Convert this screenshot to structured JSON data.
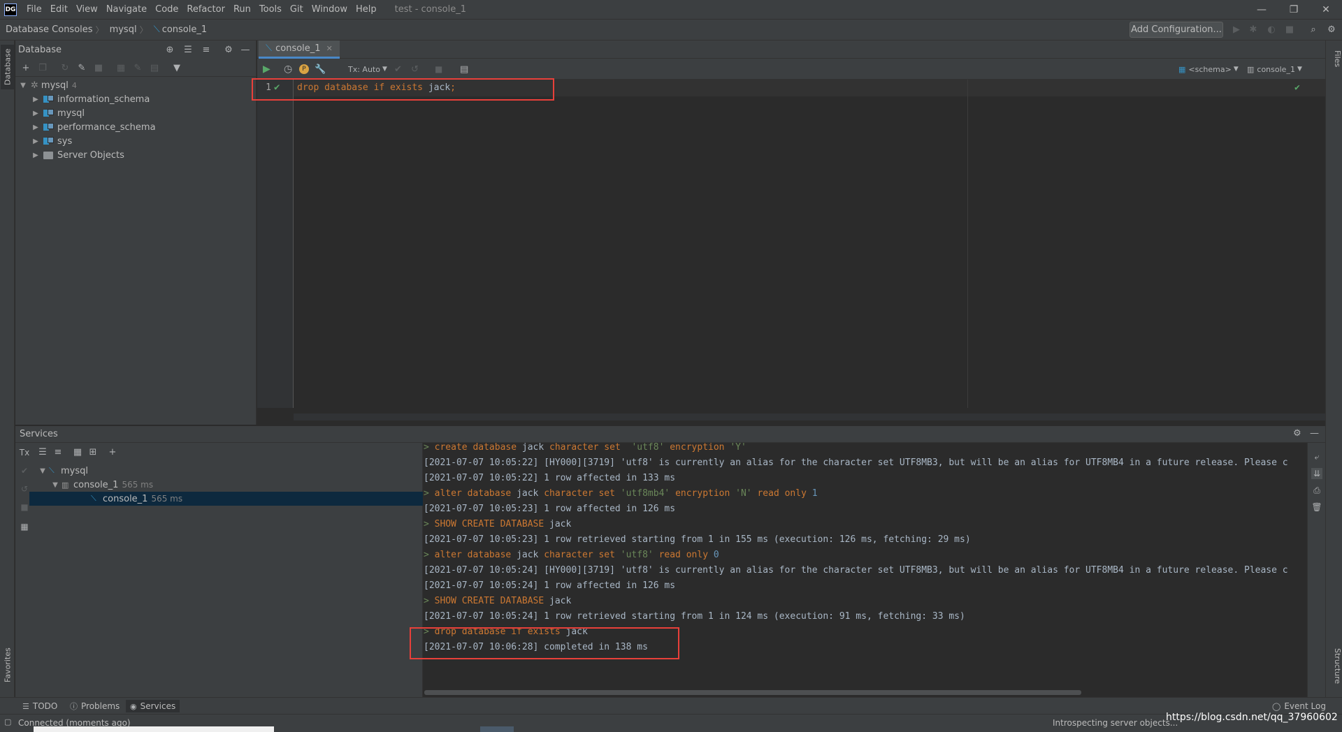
{
  "app": {
    "logo": "DG",
    "window_title": "test - console_1",
    "menu": [
      "File",
      "Edit",
      "View",
      "Navigate",
      "Code",
      "Refactor",
      "Run",
      "Tools",
      "Git",
      "Window",
      "Help"
    ],
    "window_controls": {
      "minimize": "—",
      "restore": "❐",
      "close": "✕"
    }
  },
  "navbar": {
    "breadcrumbs": [
      "Database Consoles",
      "mysql",
      "console_1"
    ],
    "add_configuration": "Add Configuration..."
  },
  "left_stripe": {
    "database_tab": "Database",
    "favorites_tab": "Favorites"
  },
  "right_stripe": {
    "files_tab": "Files",
    "structure_tab": "Structure"
  },
  "database_panel": {
    "title": "Database",
    "tree": {
      "root": {
        "label": "mysql",
        "count": "4"
      },
      "children": [
        "information_schema",
        "mysql",
        "performance_schema",
        "sys"
      ],
      "server_objects": "Server Objects"
    }
  },
  "editor": {
    "tab_label": "console_1",
    "toolbar": {
      "tx_mode": "Tx: Auto",
      "schema": "<schema>",
      "console": "console_1"
    },
    "line_number": "1",
    "code": {
      "t1": "drop database if exists ",
      "t2": "jack",
      "t3": ";"
    }
  },
  "services": {
    "title": "Services",
    "tree": {
      "root": "mysql",
      "session": {
        "label": "console_1",
        "time": "565 ms"
      },
      "console": {
        "label": "console_1",
        "time": "565 ms"
      }
    },
    "output": [
      {
        "prompt": "> ",
        "parts": [
          [
            "kw",
            "create database "
          ],
          [
            "id",
            "jack "
          ],
          [
            "kw",
            "character set  "
          ],
          [
            "str",
            "'utf8' "
          ],
          [
            "kw",
            "encryption "
          ],
          [
            "str",
            "'Y'"
          ]
        ]
      },
      {
        "prompt": "",
        "parts": [
          [
            "id",
            "[2021-07-07 10:05:22] [HY000][3719] 'utf8' is currently an alias for the character set UTF8MB3, but will be an alias for UTF8MB4 in a future release. Please c"
          ]
        ]
      },
      {
        "prompt": "",
        "parts": [
          [
            "id",
            "[2021-07-07 10:05:22] 1 row affected in 133 ms"
          ]
        ]
      },
      {
        "prompt": "> ",
        "parts": [
          [
            "kw",
            "alter database "
          ],
          [
            "id",
            "jack "
          ],
          [
            "kw",
            "character set "
          ],
          [
            "str",
            "'utf8mb4' "
          ],
          [
            "kw",
            "encryption "
          ],
          [
            "str",
            "'N' "
          ],
          [
            "kw",
            "read only "
          ],
          [
            "num",
            "1"
          ]
        ]
      },
      {
        "prompt": "",
        "parts": [
          [
            "id",
            "[2021-07-07 10:05:23] 1 row affected in 126 ms"
          ]
        ]
      },
      {
        "prompt": "> ",
        "parts": [
          [
            "kw",
            "SHOW CREATE DATABASE "
          ],
          [
            "id",
            "jack"
          ]
        ]
      },
      {
        "prompt": "",
        "parts": [
          [
            "id",
            "[2021-07-07 10:05:23] 1 row retrieved starting from 1 in 155 ms (execution: 126 ms, fetching: 29 ms)"
          ]
        ]
      },
      {
        "prompt": "> ",
        "parts": [
          [
            "kw",
            "alter database "
          ],
          [
            "id",
            "jack "
          ],
          [
            "kw",
            "character set "
          ],
          [
            "str",
            "'utf8' "
          ],
          [
            "kw",
            "read only "
          ],
          [
            "num",
            "0"
          ]
        ]
      },
      {
        "prompt": "",
        "parts": [
          [
            "id",
            "[2021-07-07 10:05:24] [HY000][3719] 'utf8' is currently an alias for the character set UTF8MB3, but will be an alias for UTF8MB4 in a future release. Please c"
          ]
        ]
      },
      {
        "prompt": "",
        "parts": [
          [
            "id",
            "[2021-07-07 10:05:24] 1 row affected in 126 ms"
          ]
        ]
      },
      {
        "prompt": "> ",
        "parts": [
          [
            "kw",
            "SHOW CREATE DATABASE "
          ],
          [
            "id",
            "jack"
          ]
        ]
      },
      {
        "prompt": "",
        "parts": [
          [
            "id",
            "[2021-07-07 10:05:24] 1 row retrieved starting from 1 in 124 ms (execution: 91 ms, fetching: 33 ms)"
          ]
        ]
      },
      {
        "prompt": "> ",
        "parts": [
          [
            "kw",
            "drop database if exists "
          ],
          [
            "id",
            "jack"
          ]
        ]
      },
      {
        "prompt": "",
        "parts": [
          [
            "id",
            "[2021-07-07 10:06:28] completed in 138 ms"
          ]
        ]
      }
    ]
  },
  "bottom_tabs": [
    "TODO",
    "Problems",
    "Services"
  ],
  "event_log": "Event Log",
  "status": {
    "left": "Connected (moments ago)",
    "right": "Introspecting server objects...",
    "watermark": "https://blog.csdn.net/qq_37960602"
  },
  "colors": {
    "keyword": "#cc7832",
    "identifier": "#a9b7c6",
    "string": "#6a8759",
    "number": "#6897bb",
    "highlight_box": "#e8403a",
    "accent": "#4a88c7"
  }
}
